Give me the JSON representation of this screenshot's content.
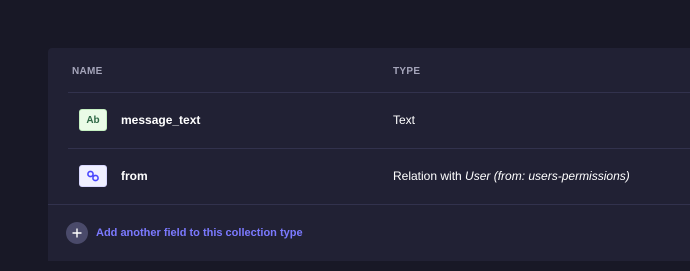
{
  "table": {
    "headers": {
      "name": "NAME",
      "type": "TYPE"
    },
    "rows": [
      {
        "icon": "text-field-icon",
        "badge_label": "Ab",
        "name": "message_text",
        "type": "Text"
      },
      {
        "icon": "relation-link-icon",
        "name": "from",
        "type_prefix": "Relation with ",
        "type_target": "User (from: users-permissions)"
      }
    ]
  },
  "add_field": {
    "icon": "plus-icon",
    "label": "Add another field to this collection type"
  },
  "colors": {
    "background": "#181826",
    "panel": "#212134",
    "divider": "#32324d",
    "header_text": "#a5a5ba",
    "text": "#ffffff",
    "accent": "#7b79ff",
    "text_badge_bg": "#eafbe7",
    "relation_badge_bg": "#f0f0ff"
  }
}
